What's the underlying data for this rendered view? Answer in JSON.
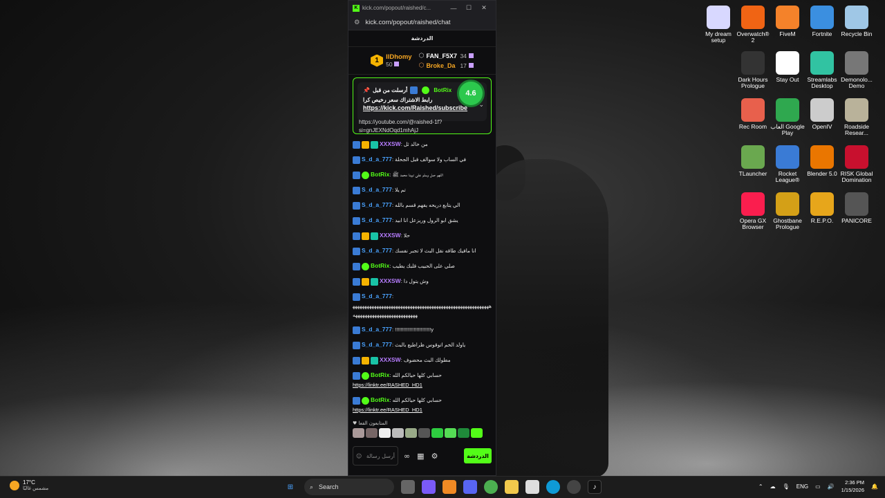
{
  "window": {
    "tab_title": "kick.com/popout/raished/c...",
    "url": "kick.com/popout/raished/chat",
    "chat_title": "الدردشة"
  },
  "leaderboard": {
    "first": {
      "rank": "1",
      "name": "llDhomy",
      "count": "50"
    },
    "second": {
      "name": "FAN_F5X7",
      "count": "34"
    },
    "third": {
      "name": "Broke_Da",
      "count": "17"
    }
  },
  "pinned": {
    "score": "4.6",
    "sender_label": "أرسلت من قبل",
    "sender": "BotRix",
    "text": "رابط الاشتراك سعر رخيص كرا",
    "link": "https://kick.com/Raished/subscribe",
    "under_line1": "https://youtube.com/@raished-1f?",
    "under_line2": "si=gnJEXNdOqd1mhAjJ"
  },
  "messages": [
    {
      "user": "XXXSW",
      "color": "#b77dff",
      "text": "من خالد ثل",
      "badges": [
        "blue",
        "crown",
        "teal"
      ]
    },
    {
      "user": "S_d_a_777",
      "color": "#4aa3ff",
      "text": "في الساب ولا سوالف قبل الجحلة",
      "badges": [
        "blue"
      ]
    },
    {
      "user": "BotRix",
      "color": "#53fc18",
      "text": "اللهم صل وسلم على نبينا محمد ﷺ",
      "badges": [
        "blue",
        "green"
      ]
    },
    {
      "user": "S_d_a_777",
      "color": "#4aa3ff",
      "text": "تم يلا",
      "badges": [
        "blue"
      ]
    },
    {
      "user": "S_d_a_777",
      "color": "#4aa3ff",
      "text": "الي يتابع دريحه يفهم قسم بالله",
      "badges": [
        "blue"
      ]
    },
    {
      "user": "S_d_a_777",
      "color": "#4aa3ff",
      "text": "يشق ابو الرول وريزعل انا ابيد",
      "badges": [
        "blue"
      ]
    },
    {
      "user": "XXXSW",
      "color": "#b77dff",
      "text": "حلا",
      "badges": [
        "blue",
        "crown",
        "teal"
      ]
    },
    {
      "user": "S_d_a_777",
      "color": "#4aa3ff",
      "text": "انا مافيك طاقه نقل البث لا تجبر نفسك",
      "badges": [
        "blue"
      ]
    },
    {
      "user": "BotRix",
      "color": "#53fc18",
      "text": "صلي على الحبيب قلبك يطيب",
      "badges": [
        "blue",
        "green"
      ]
    },
    {
      "user": "XXXSW",
      "color": "#b77dff",
      "text": "وش يتول دا",
      "badges": [
        "blue",
        "crown",
        "teal"
      ]
    },
    {
      "user": "S_d_a_777",
      "color": "#4aa3ff",
      "text": "ههههههههههههههههههههههههههههههههههههههههههههههههههههههههههههههههههههههههههههههههههههه",
      "badges": [
        "blue"
      ],
      "block": true
    },
    {
      "user": "S_d_a_777",
      "color": "#4aa3ff",
      "text": "!!!!!!!!!!!!!!!!!!!!!!!!!y",
      "badges": [
        "blue"
      ]
    },
    {
      "user": "S_d_a_777",
      "color": "#4aa3ff",
      "text": "ياولد الخم اتوقوس ظراطيع بالبث",
      "badges": [
        "blue"
      ]
    },
    {
      "user": "XXXSW",
      "color": "#b77dff",
      "text": "مطولك البث محضوف",
      "badges": [
        "blue",
        "crown",
        "teal"
      ]
    },
    {
      "user": "BotRix",
      "color": "#53fc18",
      "text": "حسابي كلها حيالكم الله",
      "badges": [
        "blue",
        "green"
      ],
      "link": "https://linktr.ee/RASHED_HD1"
    },
    {
      "user": "BotRix",
      "color": "#53fc18",
      "text": "حسابي كلها حيالكم الله",
      "badges": [
        "blue",
        "green"
      ],
      "link": "https://linktr.ee/RASHED_HD1"
    }
  ],
  "active": {
    "label": "المتابعون الفعا"
  },
  "input": {
    "placeholder": "أرسل رسالة",
    "send_label": "الدردشة"
  },
  "desktop_icons": [
    {
      "label": "My dream setup",
      "color": "#d8d8ff"
    },
    {
      "label": "Overwatch® 2",
      "color": "#f06414"
    },
    {
      "label": "FiveM",
      "color": "#f4822a"
    },
    {
      "label": "Fortnite",
      "color": "#3b8fe0"
    },
    {
      "label": "Recycle Bin",
      "color": "#9fc7e6"
    },
    {
      "label": "Dark Hours Prologue",
      "color": "#333333"
    },
    {
      "label": "Stay Out",
      "color": "#ffffff"
    },
    {
      "label": "Streamlabs Desktop",
      "color": "#31c3a2"
    },
    {
      "label": "Demonolo... Demo",
      "color": "#777777"
    },
    {
      "label": "Rec Room",
      "color": "#e8604c"
    },
    {
      "label": "العاب Google Play",
      "color": "#2fa84f"
    },
    {
      "label": "OpenIV",
      "color": "#cccccc"
    },
    {
      "label": "Roadside Resear...",
      "color": "#b9b29a"
    },
    {
      "label": "TLauncher",
      "color": "#6aa84f"
    },
    {
      "label": "Rocket League®",
      "color": "#3a7bd5"
    },
    {
      "label": "Blender 5.0",
      "color": "#ea7600"
    },
    {
      "label": "RISK Global Domination",
      "color": "#c8102e"
    },
    {
      "label": "Opera GX Browser",
      "color": "#fa1e4e"
    },
    {
      "label": "Ghostbane Prologue",
      "color": "#d4a017"
    },
    {
      "label": "R.E.P.O.",
      "color": "#e7a61b"
    },
    {
      "label": "PANICORE",
      "color": "#555555"
    }
  ],
  "taskbar": {
    "temp": "17°C",
    "weather": "مشمس غالبًا",
    "search": "Search",
    "lang": "ENG",
    "time": "2:36 PM",
    "date": "1/15/2026"
  }
}
